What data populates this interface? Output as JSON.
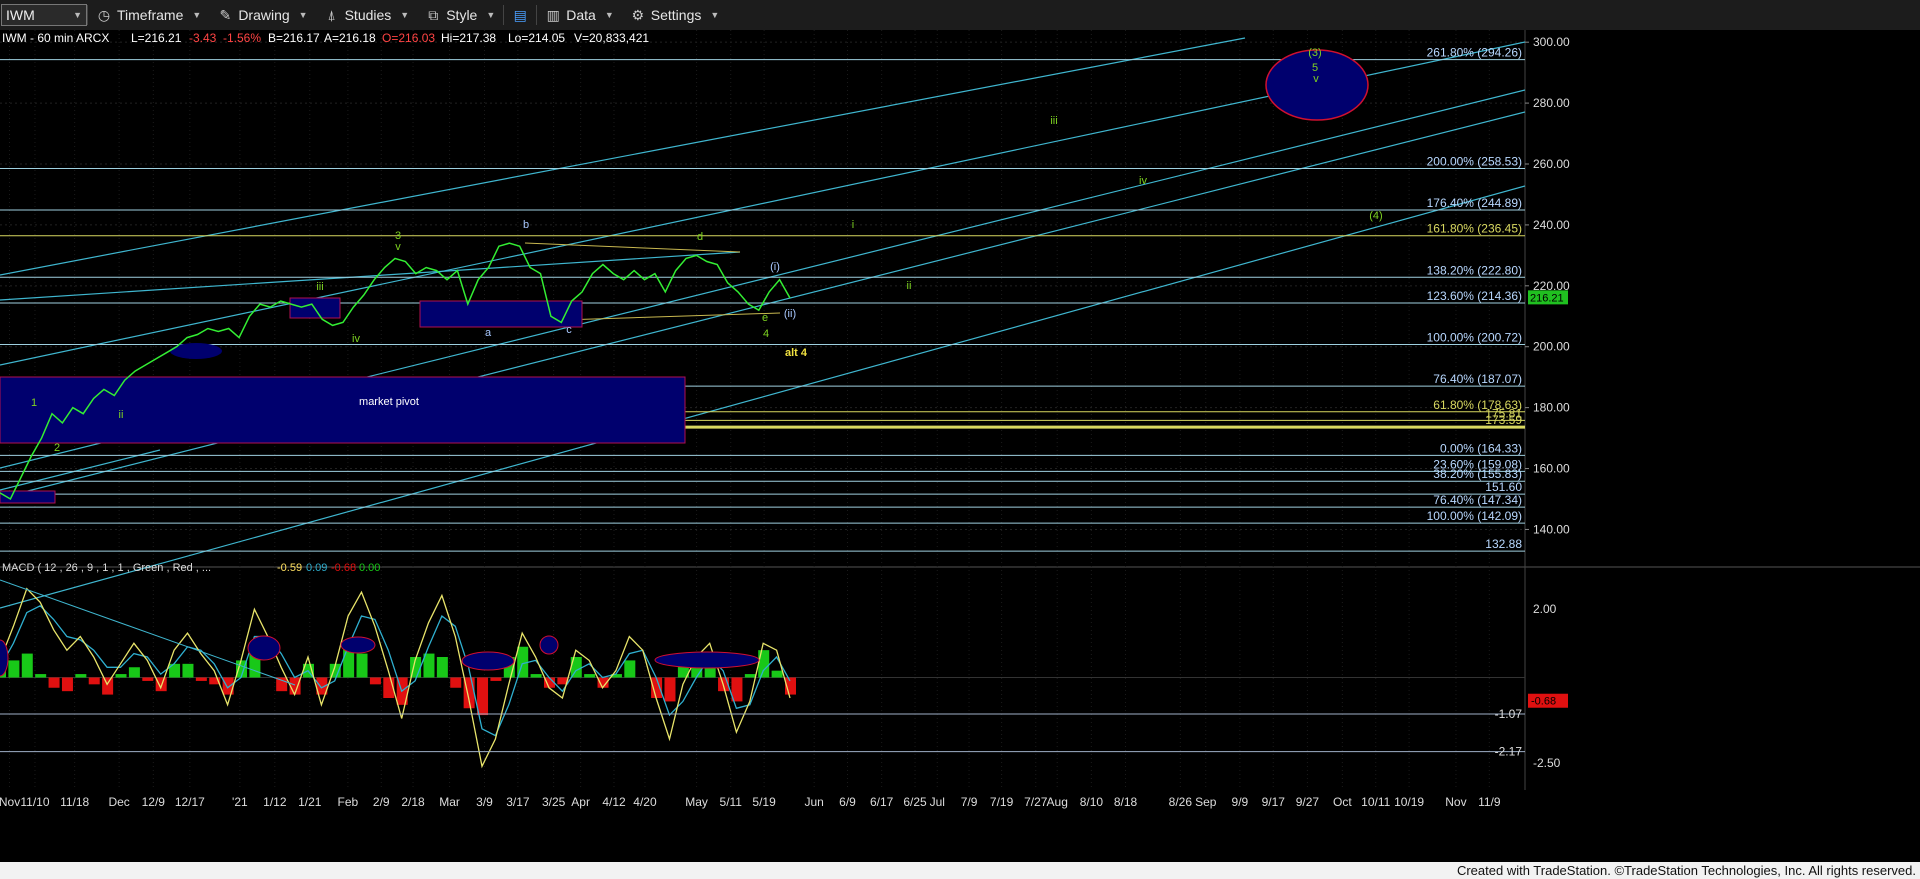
{
  "toolbar": {
    "symbol": "IWM",
    "items": [
      {
        "label": "Timeframe",
        "icon": "clock-icon"
      },
      {
        "label": "Drawing",
        "icon": "pencil-icon"
      },
      {
        "label": "Studies",
        "icon": "studies-icon"
      },
      {
        "label": "Style",
        "icon": "style-icon"
      },
      {
        "label": "Data",
        "icon": "data-icon"
      },
      {
        "label": "Settings",
        "icon": "gear-icon"
      }
    ]
  },
  "header": {
    "symbol_line": "IWM - 60 min  ARCX",
    "last": "L=216.21",
    "change": "-3.43",
    "change_pct": "-1.56%",
    "bid": "B=216.17",
    "ask": "A=216.18",
    "open": "O=216.03",
    "high": "Hi=217.38",
    "low": "Lo=214.05",
    "volume": "V=20,833,421"
  },
  "colors": {
    "price": "#33ee33",
    "channel": "#3fb6cf",
    "fib": "#9fd0e0",
    "fib_yellow": "#d8d860",
    "box": "#00006e",
    "box_border": "#b01050",
    "macd_line": "#e8e46a",
    "signal_line": "#2fb0d0",
    "hist_pos": "#18c818",
    "hist_neg": "#e01010",
    "wave_green": "#7ed321",
    "wave_light": "#a8c8ff",
    "alt_yellow": "#f0e040"
  },
  "chart_data": {
    "type": "line",
    "title": "IWM - 60 min",
    "ylim": [
      128,
      304
    ],
    "y_ticks": [
      "300.00",
      "280.00",
      "260.00",
      "240.00",
      "220.00",
      "200.00",
      "180.00",
      "160.00",
      "140.00"
    ],
    "x_tick_labels": [
      "Nov",
      "11/10",
      "11/18",
      "Dec",
      "12/9",
      "12/17",
      "'21",
      "1/12",
      "1/21",
      "Feb",
      "2/9",
      "2/18",
      "Mar",
      "3/9",
      "3/17",
      "3/25",
      "Apr",
      "4/12",
      "4/20",
      "May",
      "5/11",
      "5/19",
      "Jun",
      "6/9",
      "6/17",
      "6/25",
      "Jul",
      "7/9",
      "7/19",
      "7/27",
      "Aug",
      "8/10",
      "8/18",
      "8/26",
      "Sep",
      "9/9",
      "9/17",
      "9/27",
      "Oct",
      "10/11",
      "10/19",
      "Nov",
      "11/9"
    ],
    "last_price_label": "216.21",
    "price_series": [
      [
        0,
        152
      ],
      [
        1,
        150
      ],
      [
        2,
        157
      ],
      [
        3,
        164
      ],
      [
        4,
        170
      ],
      [
        5,
        178
      ],
      [
        6,
        175
      ],
      [
        7,
        180
      ],
      [
        8,
        178
      ],
      [
        9,
        183
      ],
      [
        10,
        186
      ],
      [
        11,
        184
      ],
      [
        12,
        189
      ],
      [
        13,
        192
      ],
      [
        14,
        194
      ],
      [
        15,
        196
      ],
      [
        16,
        198
      ],
      [
        17,
        200
      ],
      [
        18,
        203
      ],
      [
        19,
        204
      ],
      [
        20,
        206
      ],
      [
        21,
        205
      ],
      [
        22,
        206
      ],
      [
        23,
        203
      ],
      [
        24,
        210
      ],
      [
        25,
        214
      ],
      [
        26,
        213
      ],
      [
        27,
        215
      ],
      [
        28,
        214
      ],
      [
        29,
        213
      ],
      [
        30,
        214
      ],
      [
        31,
        209
      ],
      [
        32,
        207
      ],
      [
        33,
        208
      ],
      [
        34,
        213
      ],
      [
        35,
        217
      ],
      [
        36,
        222
      ],
      [
        37,
        226
      ],
      [
        38,
        229
      ],
      [
        39,
        228
      ],
      [
        40,
        224
      ],
      [
        41,
        226
      ],
      [
        42,
        225
      ],
      [
        43,
        222
      ],
      [
        44,
        225
      ],
      [
        45,
        214
      ],
      [
        46,
        222
      ],
      [
        47,
        226
      ],
      [
        48,
        233
      ],
      [
        49,
        234
      ],
      [
        50,
        233
      ],
      [
        51,
        226
      ],
      [
        52,
        224
      ],
      [
        53,
        210
      ],
      [
        54,
        208
      ],
      [
        55,
        215
      ],
      [
        56,
        218
      ],
      [
        57,
        224
      ],
      [
        58,
        227
      ],
      [
        59,
        224
      ],
      [
        60,
        222
      ],
      [
        61,
        225
      ],
      [
        62,
        222
      ],
      [
        63,
        224
      ],
      [
        64,
        218
      ],
      [
        65,
        225
      ],
      [
        66,
        229
      ],
      [
        67,
        230
      ],
      [
        68,
        228
      ],
      [
        69,
        227
      ],
      [
        70,
        221
      ],
      [
        71,
        218
      ],
      [
        72,
        214
      ],
      [
        73,
        212
      ],
      [
        74,
        218
      ],
      [
        75,
        222
      ],
      [
        76,
        216
      ]
    ],
    "fib_levels": [
      {
        "label": "261.80% (294.26)",
        "value": 294.26
      },
      {
        "label": "200.00% (258.53)",
        "value": 258.53
      },
      {
        "label": "176.40% (244.89)",
        "value": 244.89
      },
      {
        "label": "161.80% (236.45)",
        "value": 236.45
      },
      {
        "label": "138.20% (222.80)",
        "value": 222.8
      },
      {
        "label": "123.60% (214.36)",
        "value": 214.36
      },
      {
        "label": "100.00% (200.72)",
        "value": 200.72
      },
      {
        "label": "76.40% (187.07)",
        "value": 187.07
      },
      {
        "label": "61.80% (178.63)",
        "value": 178.63
      },
      {
        "label": "175.81",
        "value": 175.81
      },
      {
        "label": "173.59",
        "value": 173.59
      },
      {
        "label": "0.00% (164.33)",
        "value": 164.33
      },
      {
        "label": "23.60% (159.08)",
        "value": 159.08
      },
      {
        "label": "38.20% (155.83)",
        "value": 155.83
      },
      {
        "label": "151.60",
        "value": 151.6
      },
      {
        "label": "76.40% (147.34)",
        "value": 147.34
      },
      {
        "label": "100.00% (142.09)",
        "value": 142.09
      },
      {
        "label": "132.88",
        "value": 132.88
      }
    ],
    "wave_labels": [
      {
        "text": "1",
        "color": "green"
      },
      {
        "text": "2",
        "color": "green"
      },
      {
        "text": "ii",
        "color": "green"
      },
      {
        "text": "iii",
        "color": "green"
      },
      {
        "text": "iv",
        "color": "green"
      },
      {
        "text": "v",
        "color": "green"
      },
      {
        "text": "3",
        "color": "green"
      },
      {
        "text": "a",
        "color": "light"
      },
      {
        "text": "b",
        "color": "light"
      },
      {
        "text": "c",
        "color": "light"
      },
      {
        "text": "d",
        "color": "green"
      },
      {
        "text": "e",
        "color": "green"
      },
      {
        "text": "4",
        "color": "green"
      },
      {
        "text": "(i)",
        "color": "light"
      },
      {
        "text": "(ii)",
        "color": "light"
      },
      {
        "text": "alt 4",
        "color": "yellow"
      },
      {
        "text": "i",
        "color": "green"
      },
      {
        "text": "ii",
        "color": "green"
      },
      {
        "text": "iii",
        "color": "green"
      },
      {
        "text": "iv",
        "color": "green"
      },
      {
        "text": "(4)",
        "color": "green"
      },
      {
        "text": "(3)",
        "color": "green"
      },
      {
        "text": "5",
        "color": "green"
      },
      {
        "text": "v",
        "color": "green"
      },
      {
        "text": "market pivot",
        "color": "white"
      }
    ],
    "macd": {
      "label": "MACD ( 12 , 26 , 9 , 1 , 1 , Green , Red , ...",
      "values": [
        "-0.59",
        "0.09",
        "-0.68",
        "0.00"
      ],
      "ylim": [
        -3,
        3
      ],
      "ticks": [
        "2.00",
        "-2.50"
      ],
      "level_labels": [
        "-1.07",
        "-2.17"
      ],
      "current_label": "-0.68",
      "macd_series": [
        0.5,
        1.5,
        2.6,
        2.2,
        1.4,
        0.8,
        1.2,
        0.6,
        -0.2,
        0.4,
        1.0,
        0.5,
        -0.3,
        0.8,
        1.3,
        0.7,
        0.2,
        -0.8,
        0.5,
        2.0,
        1.2,
        0.3,
        -0.5,
        0.6,
        -0.8,
        0.3,
        1.8,
        2.5,
        1.5,
        0.2,
        -1.2,
        0.5,
        1.6,
        2.4,
        1.2,
        -0.6,
        -2.6,
        -1.8,
        -0.2,
        1.3,
        0.6,
        -0.3,
        -0.6,
        0.8,
        0.5,
        -0.3,
        0.2,
        1.2,
        0.8,
        -0.6,
        -1.8,
        -0.2,
        0.6,
        1.0,
        -0.2,
        -1.6,
        -0.7,
        1.0,
        0.8,
        -0.6
      ],
      "signal_series": [
        0.3,
        1.0,
        1.9,
        2.1,
        1.7,
        1.2,
        1.1,
        0.8,
        0.3,
        0.3,
        0.7,
        0.6,
        0.1,
        0.4,
        0.9,
        0.8,
        0.4,
        -0.3,
        0.0,
        1.2,
        1.2,
        0.7,
        0.0,
        0.2,
        -0.3,
        -0.1,
        0.9,
        1.8,
        1.7,
        0.8,
        -0.4,
        -0.1,
        0.9,
        1.8,
        1.5,
        0.3,
        -1.5,
        -1.7,
        -0.8,
        0.4,
        0.5,
        0.0,
        -0.4,
        0.2,
        0.4,
        0.0,
        0.1,
        0.7,
        0.8,
        0.0,
        -1.1,
        -0.7,
        0.0,
        0.6,
        0.2,
        -0.9,
        -0.8,
        0.2,
        0.6,
        -0.1
      ]
    }
  },
  "footer": {
    "text": "Created with TradeStation. ©TradeStation Technologies, Inc. All rights reserved."
  }
}
